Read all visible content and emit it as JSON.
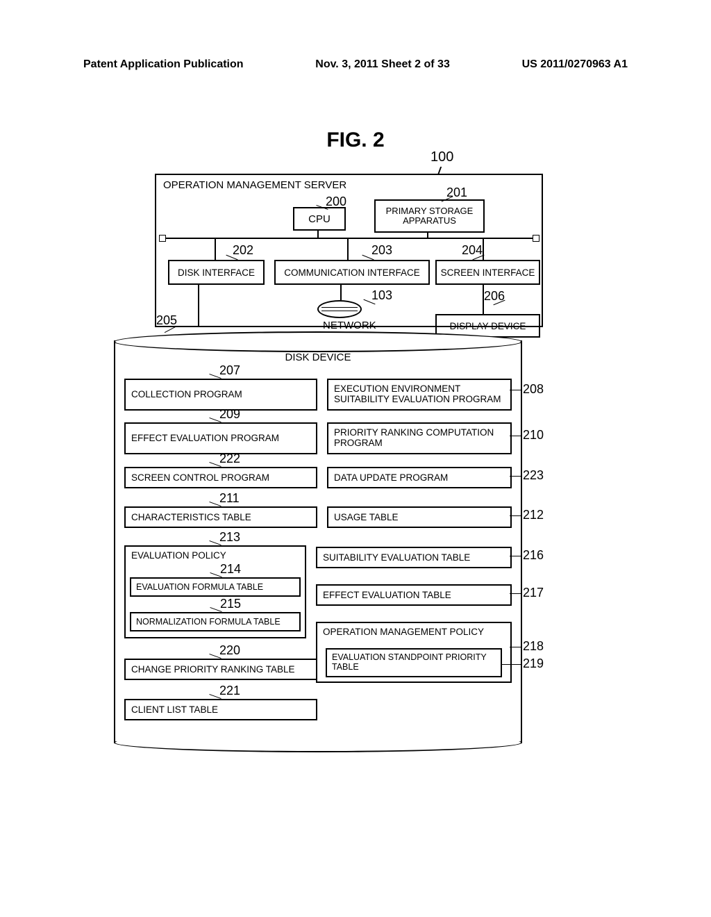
{
  "header": {
    "left": "Patent Application Publication",
    "center": "Nov. 3, 2011  Sheet 2 of 33",
    "right": "US 2011/0270963 A1"
  },
  "fig_title": "FIG. 2",
  "refs": {
    "r100": "100",
    "r200": "200",
    "r201": "201",
    "r202": "202",
    "r203": "203",
    "r204": "204",
    "r103": "103",
    "r206": "206",
    "r205": "205",
    "r207": "207",
    "r208": "208",
    "r209": "209",
    "r210": "210",
    "r222": "222",
    "r223": "223",
    "r211": "211",
    "r212": "212",
    "r213": "213",
    "r216": "216",
    "r214": "214",
    "r217": "217",
    "r215": "215",
    "r218": "218",
    "r219": "219",
    "r220": "220",
    "r221": "221"
  },
  "server": {
    "title": "OPERATION MANAGEMENT SERVER",
    "cpu": "CPU",
    "storage": "PRIMARY STORAGE APPARATUS",
    "disk_if": "DISK INTERFACE",
    "comm_if": "COMMUNICATION INTERFACE",
    "screen_if": "SCREEN INTERFACE",
    "network": "NETWORK",
    "display": "DISPLAY DEVICE"
  },
  "disk": {
    "title": "DISK DEVICE",
    "b207": "COLLECTION PROGRAM",
    "b208": "EXECUTION ENVIRONMENT SUITABILITY EVALUATION PROGRAM",
    "b209": "EFFECT EVALUATION PROGRAM",
    "b210": "PRIORITY RANKING COMPUTATION PROGRAM",
    "b222": "SCREEN CONTROL PROGRAM",
    "b223": "DATA UPDATE PROGRAM",
    "b211": "CHARACTERISTICS TABLE",
    "b212": "USAGE TABLE",
    "b213": "EVALUATION POLICY",
    "b216": "SUITABILITY EVALUATION TABLE",
    "b214": "EVALUATION FORMULA TABLE",
    "b217": "EFFECT EVALUATION TABLE",
    "b215": "NORMALIZATION FORMULA TABLE",
    "b218": "OPERATION MANAGEMENT POLICY",
    "b219": "EVALUATION STANDPOINT PRIORITY TABLE",
    "b220": "CHANGE PRIORITY RANKING TABLE",
    "b221": "CLIENT LIST TABLE"
  }
}
